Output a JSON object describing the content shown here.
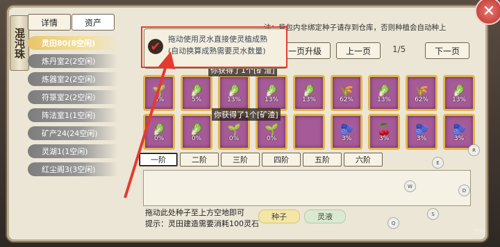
{
  "panel_title": "混沌珠",
  "tabs": [
    "详情",
    "资产"
  ],
  "sidebar": {
    "items": [
      {
        "label": "灵田80(8空闲)",
        "selected": true
      },
      {
        "label": "炼丹室2(2空闲)",
        "selected": false
      },
      {
        "label": "炼器室2(2空闲)",
        "selected": false
      },
      {
        "label": "符箓室2(2空闲)",
        "selected": false
      },
      {
        "label": "阵法室1(1空闲)",
        "selected": false
      },
      {
        "label": "矿产24(24空闲)",
        "selected": false
      },
      {
        "label": "灵湖1(1空闲)",
        "selected": false
      },
      {
        "label": "红尘阁3(3空闲)",
        "selected": false
      }
    ]
  },
  "notice": "注：背包内非绑定种子请存到仓库，否则种植会自动种上",
  "toolbar": {
    "upgrade": "一页升级",
    "prev": "上一页",
    "page": "1/5",
    "next": "下一页"
  },
  "popup": {
    "line1": "拖动使用灵水直接使灵植成熟",
    "line2": "(自动换算成熟需要灵水数量)"
  },
  "messages": [
    {
      "prefix": "你获得了",
      "count": "1",
      "item": "个[矿渣]"
    },
    {
      "prefix": "你获得了",
      "count": "1",
      "item": "个[矿渣]"
    }
  ],
  "plots_row1": [
    {
      "pct": "3%",
      "plant": "🌱"
    },
    {
      "pct": "5%",
      "plant": "🥬"
    },
    {
      "pct": "13%",
      "plant": "🥬"
    },
    {
      "pct": "13%",
      "plant": "🥬"
    },
    {
      "pct": "13%",
      "plant": "🥬"
    },
    {
      "pct": "62%",
      "plant": "🌾"
    },
    {
      "pct": "13%",
      "plant": "🥬"
    },
    {
      "pct": "62%",
      "plant": "🌾"
    },
    {
      "pct": "13%",
      "plant": "🥬"
    }
  ],
  "plots_row2": [
    {
      "pct": "0%",
      "plant": "🥬"
    },
    {
      "pct": "0%",
      "plant": "🥬"
    },
    {
      "pct": "0%",
      "plant": "🌱"
    },
    {
      "pct": "0%",
      "plant": "🌱"
    },
    {
      "pct": "",
      "plant": ""
    },
    {
      "pct": "3%",
      "plant": "🫐"
    },
    {
      "pct": "3%",
      "plant": "🍒"
    },
    {
      "pct": "3%",
      "plant": "🫐"
    },
    {
      "pct": "3%",
      "plant": "🫐"
    }
  ],
  "tiers": [
    "一阶",
    "二阶",
    "三阶",
    "四阶",
    "五阶",
    "六阶"
  ],
  "hint1": "拖动此处种子至上方空地即可",
  "hint2": "提示：灵田建造需要消耗100灵石",
  "pills": [
    "种子",
    "灵液"
  ],
  "side_bubbles": [
    "R",
    "E",
    "D",
    "W",
    "S",
    "Q"
  ],
  "corner_label": "空格"
}
